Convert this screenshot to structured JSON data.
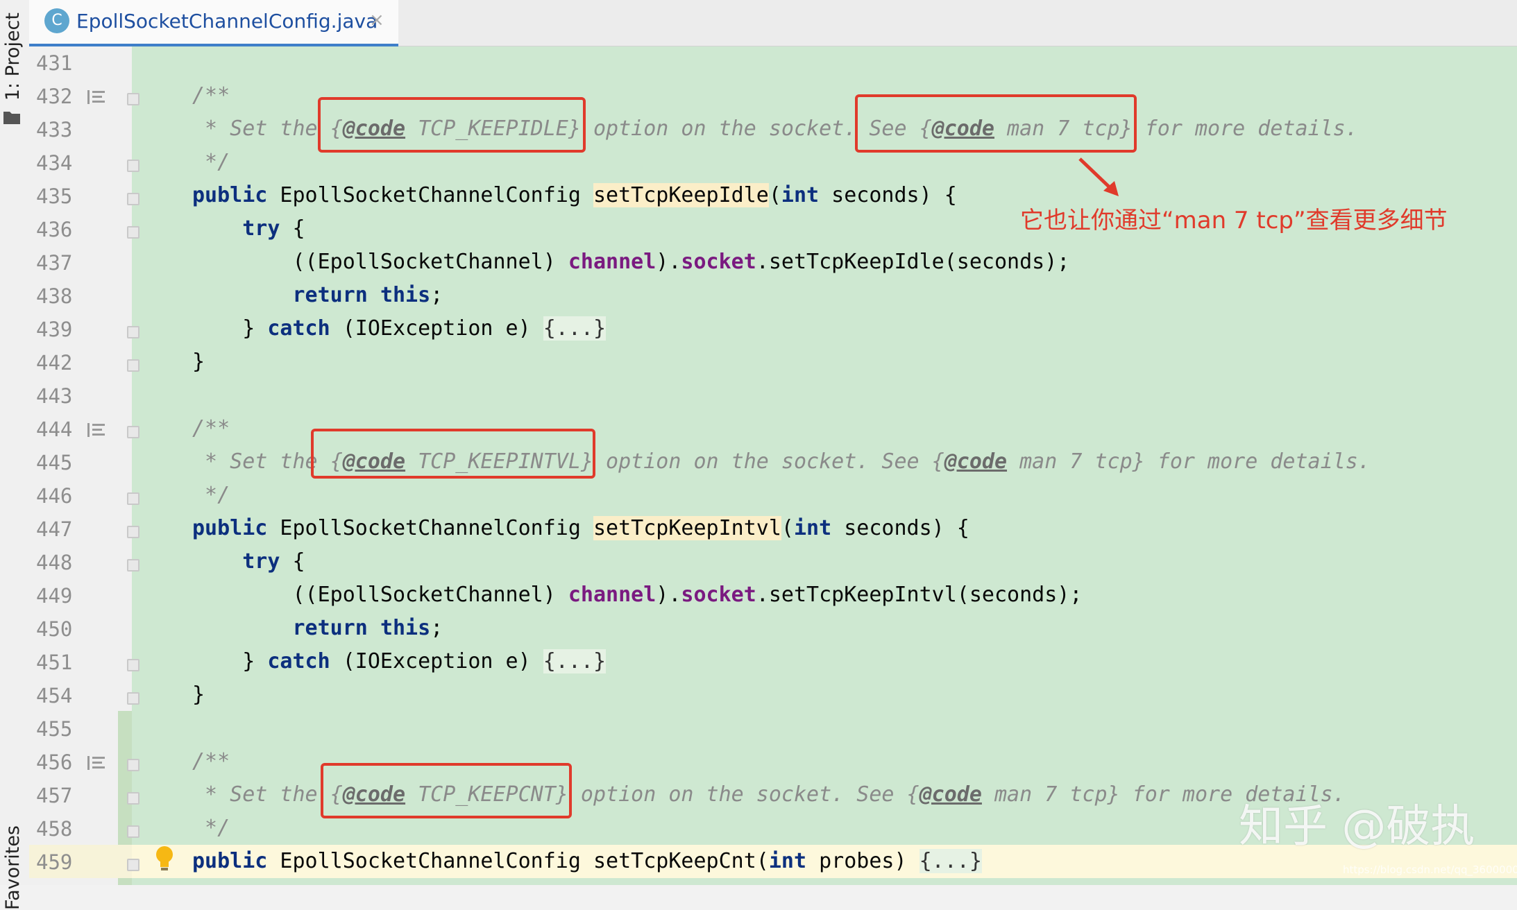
{
  "side_panel": {
    "project_label": "1: Project",
    "favorites_label": "Favorites"
  },
  "tab": {
    "icon_letter": "C",
    "title": "EpollSocketChannelConfig.java",
    "close_glyph": "×"
  },
  "lines": [
    {
      "num": "431",
      "parts": []
    },
    {
      "num": "432",
      "parts": [
        [
          "cm",
          "/**"
        ]
      ]
    },
    {
      "num": "433",
      "parts": [
        [
          "cm",
          " * Set the "
        ],
        [
          "cm",
          "{"
        ],
        [
          "tag",
          "@code"
        ],
        [
          "cm",
          " TCP_KEEPIDLE}"
        ],
        [
          "cm",
          " option on the socket. See {"
        ],
        [
          "tag",
          "@code"
        ],
        [
          "cm",
          " man 7 tcp}"
        ],
        [
          "cm",
          " for more details."
        ]
      ]
    },
    {
      "num": "434",
      "parts": [
        [
          "cm",
          " */"
        ]
      ]
    },
    {
      "num": "435",
      "parts": [
        [
          "kw",
          "public"
        ],
        [
          "",
          " EpollSocketChannelConfig "
        ],
        [
          "mhl",
          "setTcpKeepIdle"
        ],
        [
          "",
          "("
        ],
        [
          "kw",
          "int"
        ],
        [
          "",
          " seconds) {"
        ]
      ]
    },
    {
      "num": "436",
      "parts": [
        [
          "",
          "    "
        ],
        [
          "kw",
          "try"
        ],
        [
          "",
          " {"
        ]
      ]
    },
    {
      "num": "437",
      "parts": [
        [
          "",
          "        ((EpollSocketChannel) "
        ],
        [
          "fld",
          "channel"
        ],
        [
          "",
          ")."
        ],
        [
          "fld",
          "socket"
        ],
        [
          "",
          ".setTcpKeepIdle(seconds);"
        ]
      ]
    },
    {
      "num": "438",
      "parts": [
        [
          "",
          "        "
        ],
        [
          "kw",
          "return"
        ],
        [
          "",
          " "
        ],
        [
          "kw",
          "this"
        ],
        [
          "",
          ";"
        ]
      ]
    },
    {
      "num": "439",
      "parts": [
        [
          "",
          "    } "
        ],
        [
          "kw",
          "catch"
        ],
        [
          "",
          " (IOException e) "
        ],
        [
          "fold-tx",
          "{...}"
        ]
      ]
    },
    {
      "num": "442",
      "parts": [
        [
          "",
          "}"
        ]
      ]
    },
    {
      "num": "443",
      "parts": []
    },
    {
      "num": "444",
      "parts": [
        [
          "cm",
          "/**"
        ]
      ]
    },
    {
      "num": "445",
      "parts": [
        [
          "cm",
          " * Set the "
        ],
        [
          "cm",
          "{"
        ],
        [
          "tag",
          "@code"
        ],
        [
          "cm",
          " TCP_KEEPINTVL}"
        ],
        [
          "cm",
          " option on the socket. See {"
        ],
        [
          "tag",
          "@code"
        ],
        [
          "cm",
          " man 7 tcp}"
        ],
        [
          "cm",
          " for more details."
        ]
      ]
    },
    {
      "num": "446",
      "parts": [
        [
          "cm",
          " */"
        ]
      ]
    },
    {
      "num": "447",
      "parts": [
        [
          "kw",
          "public"
        ],
        [
          "",
          " EpollSocketChannelConfig "
        ],
        [
          "mhl",
          "setTcpKeepIntvl"
        ],
        [
          "",
          "("
        ],
        [
          "kw",
          "int"
        ],
        [
          "",
          " seconds) {"
        ]
      ]
    },
    {
      "num": "448",
      "parts": [
        [
          "",
          "    "
        ],
        [
          "kw",
          "try"
        ],
        [
          "",
          " {"
        ]
      ]
    },
    {
      "num": "449",
      "parts": [
        [
          "",
          "        ((EpollSocketChannel) "
        ],
        [
          "fld",
          "channel"
        ],
        [
          "",
          ")."
        ],
        [
          "fld",
          "socket"
        ],
        [
          "",
          ".setTcpKeepIntvl(seconds);"
        ]
      ]
    },
    {
      "num": "450",
      "parts": [
        [
          "",
          "        "
        ],
        [
          "kw",
          "return"
        ],
        [
          "",
          " "
        ],
        [
          "kw",
          "this"
        ],
        [
          "",
          ";"
        ]
      ]
    },
    {
      "num": "451",
      "parts": [
        [
          "",
          "    } "
        ],
        [
          "kw",
          "catch"
        ],
        [
          "",
          " (IOException e) "
        ],
        [
          "fold-tx",
          "{...}"
        ]
      ]
    },
    {
      "num": "454",
      "parts": [
        [
          "",
          "}"
        ]
      ]
    },
    {
      "num": "455",
      "parts": []
    },
    {
      "num": "456",
      "parts": [
        [
          "cm",
          "/**"
        ]
      ]
    },
    {
      "num": "457",
      "parts": [
        [
          "cm",
          " * Set the "
        ],
        [
          "cm",
          "{"
        ],
        [
          "tag",
          "@code"
        ],
        [
          "cm",
          " TCP_KEEPCNT}"
        ],
        [
          "cm",
          " option on the socket. See {"
        ],
        [
          "tag",
          "@code"
        ],
        [
          "cm",
          " man 7 tcp}"
        ],
        [
          "cm",
          " for more details."
        ]
      ]
    },
    {
      "num": "458",
      "parts": [
        [
          "cm",
          " */"
        ]
      ]
    },
    {
      "num": "459",
      "parts": [
        [
          "kw",
          "public"
        ],
        [
          "",
          " EpollSocketChannelConfig setTcpKeepCnt("
        ],
        [
          "kw",
          "int"
        ],
        [
          "",
          " probes) "
        ],
        [
          "fold-tx",
          "{...}"
        ]
      ]
    }
  ],
  "annotation": {
    "text": "它也让你通过“man 7 tcp”查看更多细节"
  },
  "watermark": {
    "text": "知乎 @破执",
    "url": "https://blog.csdn.net/qq_36000000"
  },
  "colors": {
    "editor_bg": "#cee8d1",
    "annotation_red": "#e03a2b",
    "tab_accent": "#3e7fc9"
  }
}
